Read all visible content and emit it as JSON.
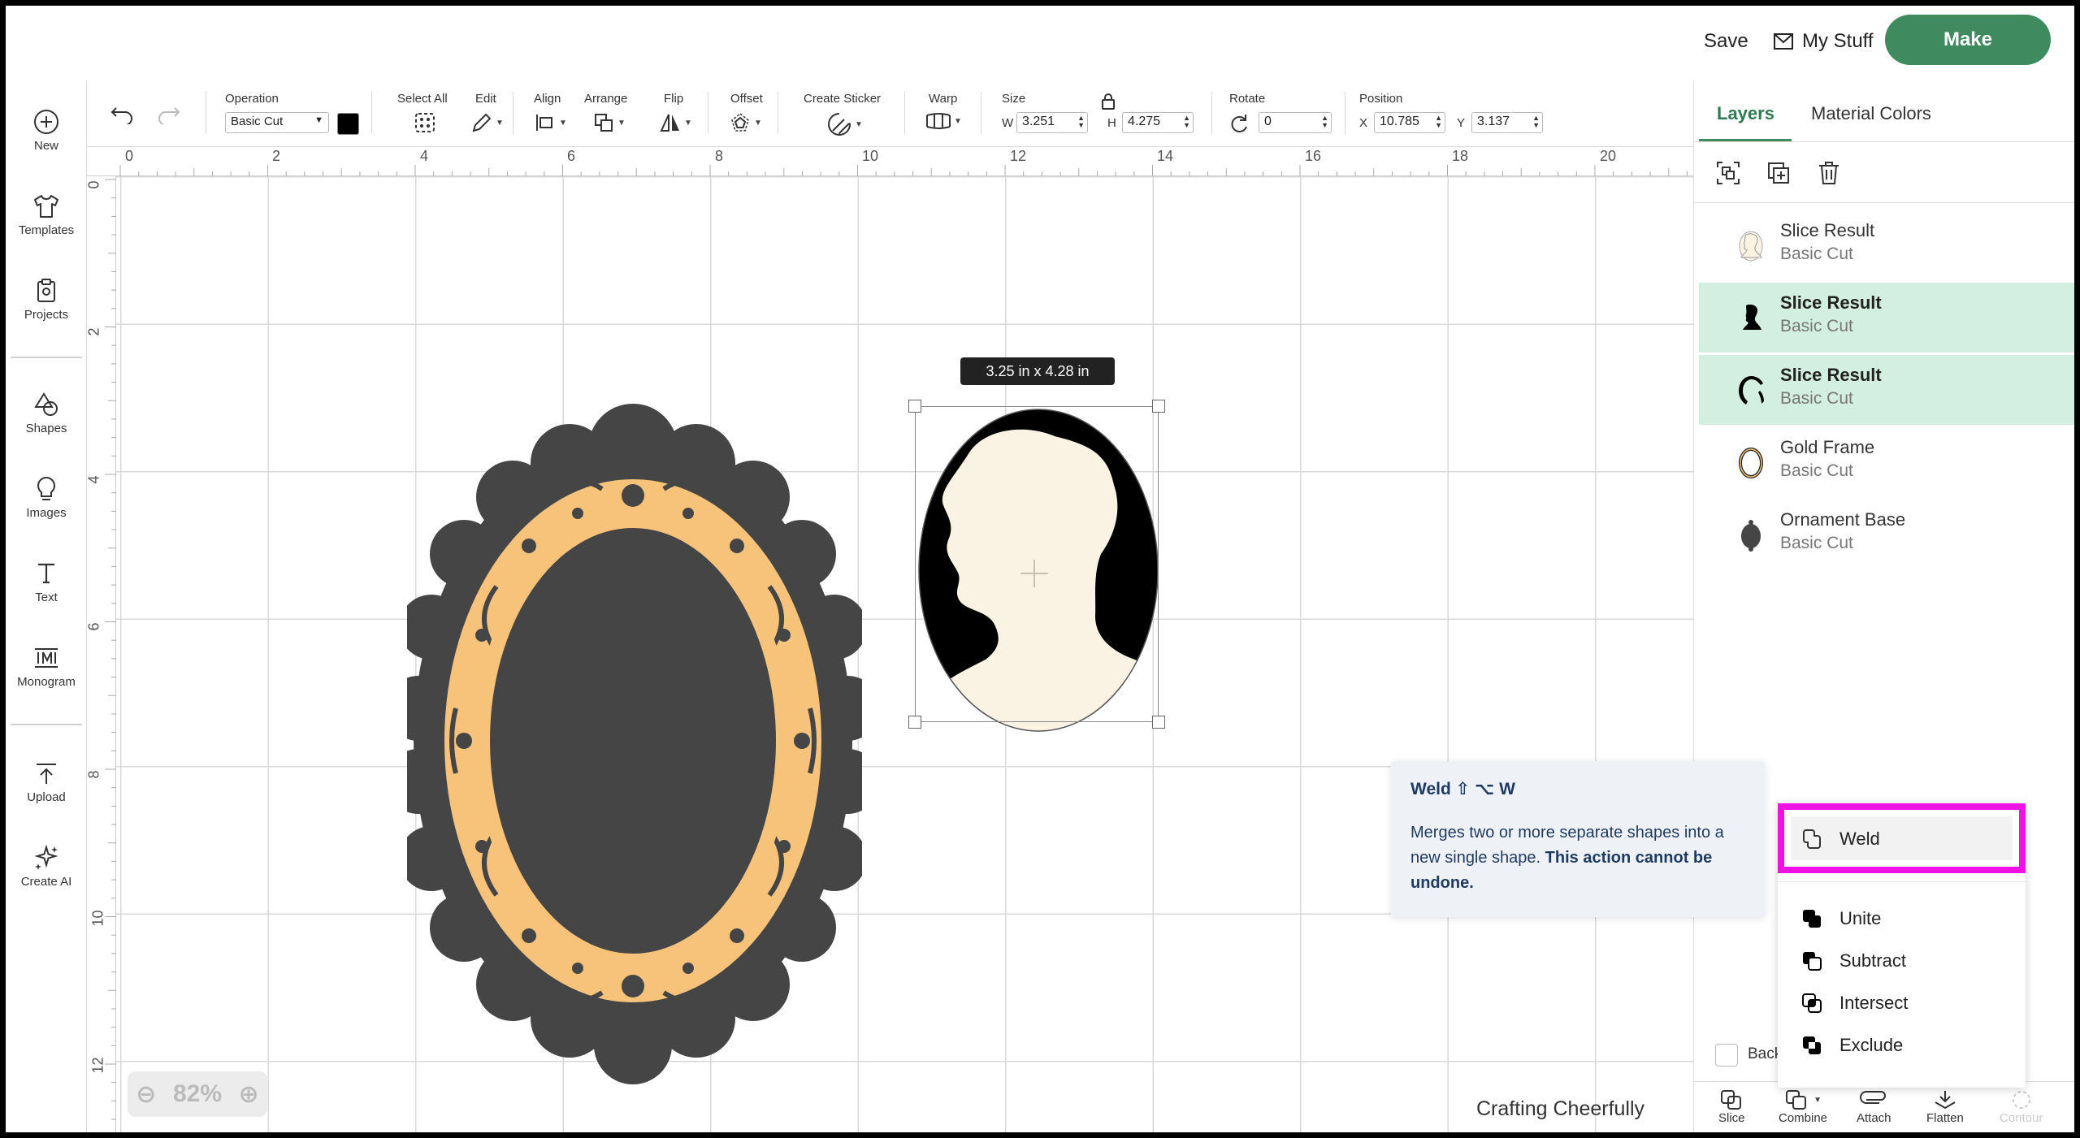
{
  "header": {
    "save_label": "Save",
    "mystuff_label": "My Stuff",
    "make_label": "Make"
  },
  "sidebar": {
    "items": [
      {
        "label": "New",
        "icon": "plus-circle-icon"
      },
      {
        "label": "Templates",
        "icon": "shirt-icon"
      },
      {
        "label": "Projects",
        "icon": "clipboard-icon"
      },
      {
        "label": "Shapes",
        "icon": "shapes-icon"
      },
      {
        "label": "Images",
        "icon": "lightbulb-icon"
      },
      {
        "label": "Text",
        "icon": "text-icon"
      },
      {
        "label": "Monogram",
        "icon": "monogram-icon"
      },
      {
        "label": "Upload",
        "icon": "upload-icon"
      },
      {
        "label": "Create AI",
        "icon": "sparkle-icon"
      }
    ]
  },
  "toolbar": {
    "operation_label": "Operation",
    "operation_value": "Basic Cut",
    "operation_color": "#000000",
    "select_all_label": "Select All",
    "edit_label": "Edit",
    "align_label": "Align",
    "arrange_label": "Arrange",
    "flip_label": "Flip",
    "offset_label": "Offset",
    "create_sticker_label": "Create Sticker",
    "warp_label": "Warp",
    "size_label": "Size",
    "w_letter": "W",
    "w_value": "3.251",
    "h_letter": "H",
    "h_value": "4.275",
    "rotate_label": "Rotate",
    "rotate_value": "0",
    "position_label": "Position",
    "x_letter": "X",
    "x_value": "10.785",
    "y_letter": "Y",
    "y_value": "3.137"
  },
  "rulers": {
    "top": [
      "0",
      "2",
      "4",
      "6",
      "8",
      "10",
      "12",
      "14",
      "16",
      "18",
      "20"
    ],
    "left": [
      "0",
      "2",
      "4",
      "6",
      "8",
      "10",
      "12"
    ]
  },
  "canvas": {
    "size_tag": "3.25  in x 4.28  in",
    "zoom": "82%",
    "brand": "Crafting Cheerfully"
  },
  "colors": {
    "accent": "#3f8a5e",
    "frame_gold": "#f7c27a",
    "base_dark": "#454545",
    "cream": "#faf3e4",
    "highlight": "#ee12e3"
  },
  "panel": {
    "tabs": [
      "Layers",
      "Material Colors"
    ],
    "layers": [
      {
        "name": "Slice Result",
        "op": "Basic Cut",
        "selected": false
      },
      {
        "name": "Slice Result",
        "op": "Basic Cut",
        "selected": true
      },
      {
        "name": "Slice Result",
        "op": "Basic Cut",
        "selected": true
      },
      {
        "name": "Gold Frame",
        "op": "Basic Cut",
        "selected": false
      },
      {
        "name": "Ornament Base",
        "op": "Basic Cut",
        "selected": false
      }
    ],
    "blank_label": "Back",
    "bottom": [
      "Slice",
      "Combine",
      "Attach",
      "Flatten",
      "Contour"
    ]
  },
  "tooltip": {
    "title": "Weld ⇧ ⌥ W",
    "body_plain": "Merges two or more separate shapes into a new single shape. ",
    "body_bold": "This action cannot be undone."
  },
  "combine_menu": {
    "items": [
      "Weld",
      "Unite",
      "Subtract",
      "Intersect",
      "Exclude"
    ]
  }
}
